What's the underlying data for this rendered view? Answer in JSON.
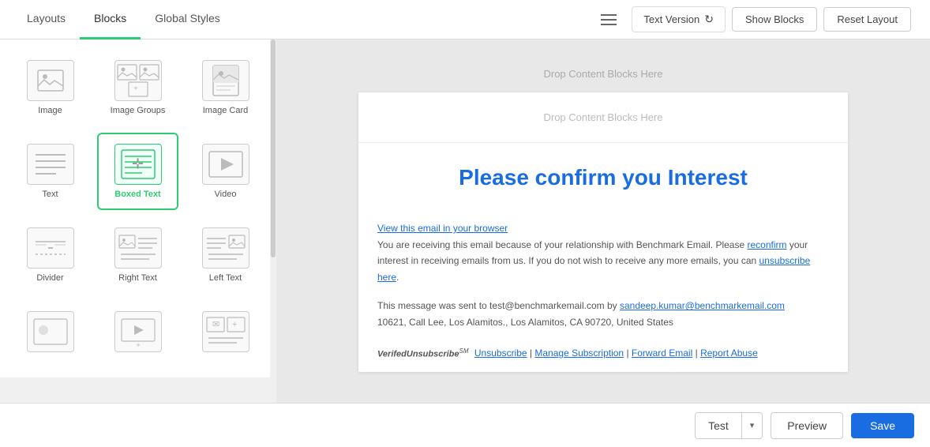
{
  "nav": {
    "tabs": [
      {
        "label": "Layouts",
        "id": "layouts",
        "active": false
      },
      {
        "label": "Blocks",
        "id": "blocks",
        "active": true
      },
      {
        "label": "Global Styles",
        "id": "global-styles",
        "active": false
      }
    ],
    "text_version_label": "Text Version",
    "show_blocks_label": "Show Blocks",
    "reset_layout_label": "Reset Layout"
  },
  "blocks": [
    {
      "id": "image",
      "label": "Image",
      "active": false
    },
    {
      "id": "image-groups",
      "label": "Image Groups",
      "active": false
    },
    {
      "id": "image-card",
      "label": "Image Card",
      "active": false
    },
    {
      "id": "text",
      "label": "Text",
      "active": false
    },
    {
      "id": "boxed-text",
      "label": "Boxed Text",
      "active": true
    },
    {
      "id": "video",
      "label": "Video",
      "active": false
    },
    {
      "id": "divider",
      "label": "Divider",
      "active": false
    },
    {
      "id": "right-text",
      "label": "Right Text",
      "active": false
    },
    {
      "id": "left-text",
      "label": "Left Text",
      "active": false
    },
    {
      "id": "bottom1",
      "label": "",
      "active": false
    },
    {
      "id": "bottom2",
      "label": "",
      "active": false
    },
    {
      "id": "bottom3",
      "label": "",
      "active": false
    }
  ],
  "canvas": {
    "outer_drop_label": "Drop Content Blocks Here",
    "inner_drop_label": "Drop Content Blocks Here",
    "email_heading": "Please confirm you Interest",
    "view_browser_link": "View this email in your browser",
    "para1": "You are receiving this email because of your relationship with Benchmark Email. Please ",
    "reconfirm_link": "reconfirm",
    "para1b": " your interest in receiving emails from us. If you do not wish to receive any more emails, you can ",
    "unsubscribe_link": "unsubscribe here",
    "para1c": ".",
    "sent_to": "This message was sent to test@benchmarkemail.com by ",
    "sender_email": "sandeep.kumar@benchmarkemail.com",
    "address": "10621, Call Lee, Los Alamitos., Los Alamitos, CA 90720, United States",
    "verified_text": "VerfiedUnsubscribe",
    "sm_text": "SM",
    "unsubscribe_label": "Unsubscribe",
    "manage_label": "Manage Subscription",
    "forward_label": "Forward Email",
    "report_label": "Report Abuse"
  },
  "bottom_bar": {
    "test_label": "Test",
    "preview_label": "Preview",
    "save_label": "Save"
  }
}
